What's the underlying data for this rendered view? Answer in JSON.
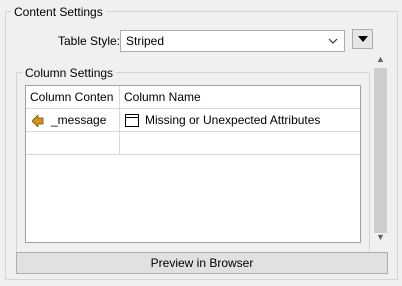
{
  "content_settings": {
    "title": "Content Settings",
    "table_style": {
      "label": "Table Style:",
      "value": "Striped"
    }
  },
  "column_settings": {
    "title": "Column Settings",
    "headers": [
      "Column Conten",
      "Column Name"
    ],
    "rows": [
      {
        "content": "_message",
        "name": "Missing or Unexpected Attributes"
      }
    ]
  },
  "buttons": {
    "preview_label": "Preview in Browser"
  },
  "icons": {
    "attribute": "attribute-arrow-icon",
    "table": "table-icon",
    "dropdown": "triangle-down-icon",
    "chevron": "chevron-down-icon"
  },
  "colors": {
    "attribute_icon": "#d4941c",
    "background": "#f0f0f0"
  }
}
